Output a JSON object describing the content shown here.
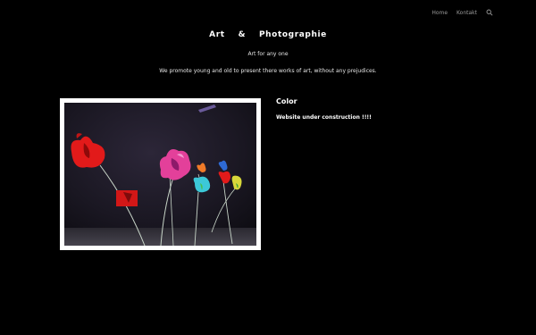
{
  "nav": {
    "items": [
      {
        "label": "Home"
      },
      {
        "label": "Kontakt"
      }
    ],
    "search_icon": "search-icon"
  },
  "header": {
    "title": "Art    &    Photographie",
    "tagline": "Art for any one",
    "mission": "We promote young and old to present there works of art, without any prejudices."
  },
  "content": {
    "image_alt": "flowers-artwork",
    "section_title": "Color",
    "status": "Website under construction !!!!"
  },
  "colors": {
    "background": "#000000",
    "text": "#ffffff",
    "nav_text": "#9a9a9a",
    "frame": "#ffffff"
  }
}
